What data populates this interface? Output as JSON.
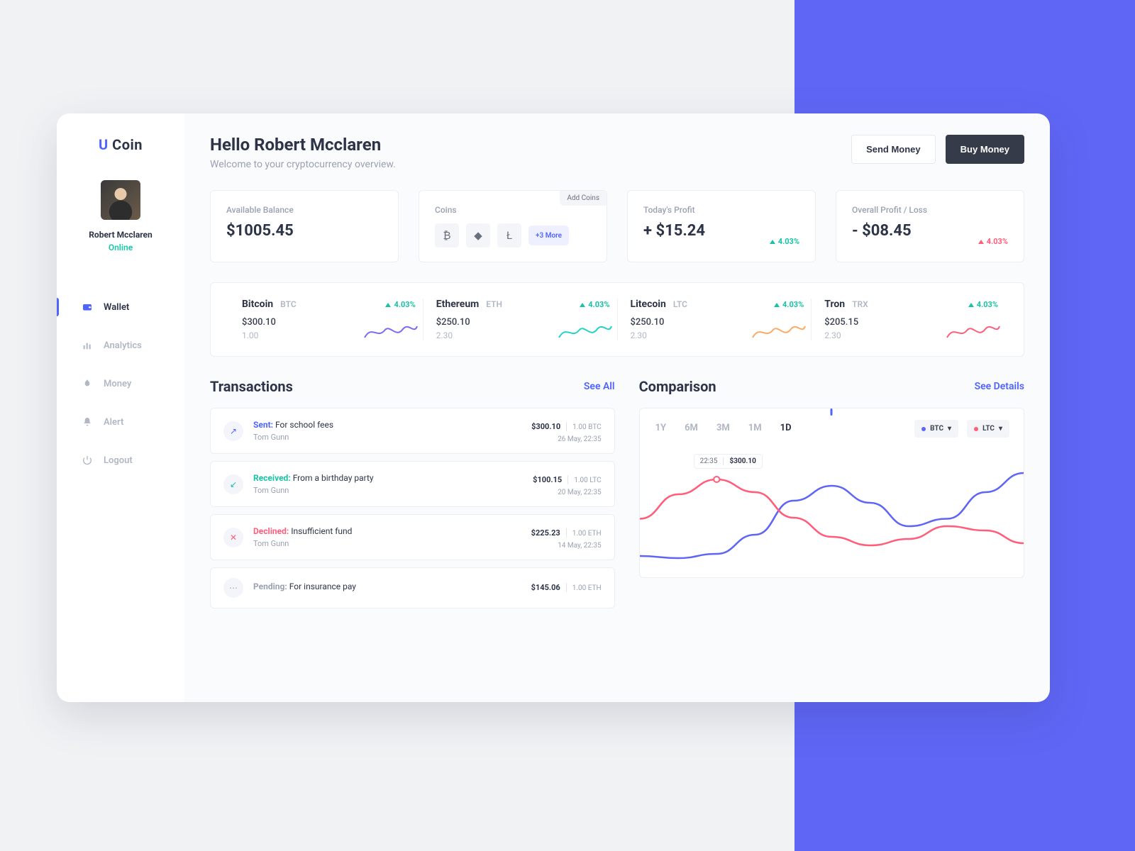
{
  "brand": {
    "u": "U",
    "coin": "Coin"
  },
  "user": {
    "name": "Robert Mcclaren",
    "status": "Online"
  },
  "nav": {
    "wallet": "Wallet",
    "analytics": "Analytics",
    "money": "Money",
    "alert": "Alert",
    "logout": "Logout"
  },
  "header": {
    "greeting": "Hello Robert Mcclaren",
    "subtitle": "Welcome to your cryptocurrency overview.",
    "send": "Send Money",
    "buy": "Buy Money"
  },
  "cards": {
    "balance": {
      "label": "Available Balance",
      "value": "$1005.45"
    },
    "coins": {
      "label": "Coins",
      "add": "Add Coins",
      "more": "+3 More",
      "sym1": "₿",
      "sym2": "◆",
      "sym3": "Ł"
    },
    "today": {
      "label": "Today's Profit",
      "value": "+ $15.24",
      "pct": "4.03%"
    },
    "overall": {
      "label": "Overall Profit / Loss",
      "value": "- $08.45",
      "pct": "4.03%"
    }
  },
  "coins": [
    {
      "name": "Bitcoin",
      "sym": "BTC",
      "price": "$300.10",
      "qty": "1.00",
      "pct": "4.03%",
      "spark_color": "#7a6bf4"
    },
    {
      "name": "Ethereum",
      "sym": "ETH",
      "price": "$250.10",
      "qty": "2.30",
      "pct": "4.03%",
      "spark_color": "#23d3c6"
    },
    {
      "name": "Litecoin",
      "sym": "LTC",
      "price": "$250.10",
      "qty": "2.30",
      "pct": "4.03%",
      "spark_color": "#ffa963"
    },
    {
      "name": "Tron",
      "sym": "TRX",
      "price": "$205.15",
      "qty": "2.30",
      "pct": "4.03%",
      "spark_color": "#ff5d7a"
    }
  ],
  "transactions": {
    "title": "Transactions",
    "link": "See All",
    "items": [
      {
        "status": "Sent:",
        "cls": "sent",
        "desc": "For school fees",
        "who": "Tom Gunn",
        "amt": "$300.10",
        "coin": "1.00 BTC",
        "date": "26 May, 22:35",
        "icon": "↗",
        "iconColor": "#4f63ff"
      },
      {
        "status": "Received:",
        "cls": "recv",
        "desc": "From a birthday party",
        "who": "Tom Gunn",
        "amt": "$100.15",
        "coin": "1.00 LTC",
        "date": "20 May, 22:35",
        "icon": "↙",
        "iconColor": "#17c3a4"
      },
      {
        "status": "Declined:",
        "cls": "decl",
        "desc": "Insufficient fund",
        "who": "Tom Gunn",
        "amt": "$225.23",
        "coin": "1.00 ETH",
        "date": "14 May, 22:35",
        "icon": "✕",
        "iconColor": "#ff5d7a"
      },
      {
        "status": "Pending:",
        "cls": "pend",
        "desc": "For insurance pay",
        "who": "",
        "amt": "$145.06",
        "coin": "1.00 ETH",
        "date": "",
        "icon": "⋯",
        "iconColor": "#9aa1b1"
      }
    ]
  },
  "comparison": {
    "title": "Comparison",
    "link": "See Details",
    "ranges": {
      "r1": "1Y",
      "r2": "6M",
      "r3": "3M",
      "r4": "1M",
      "r5": "1D"
    },
    "sel1": "BTC",
    "sel2": "LTC",
    "tooltip_time": "22:35",
    "tooltip_val": "$300.10"
  },
  "chart_data": {
    "type": "line",
    "x": [
      0,
      1,
      2,
      3,
      4,
      5,
      6,
      7,
      8,
      9,
      10
    ],
    "series": [
      {
        "name": "BTC",
        "color": "#5f66f5",
        "values": [
          20,
          18,
          22,
          40,
          72,
          86,
          70,
          48,
          55,
          80,
          98
        ]
      },
      {
        "name": "LTC",
        "color": "#ff5d7a",
        "values": [
          55,
          78,
          92,
          80,
          56,
          38,
          30,
          36,
          48,
          44,
          32
        ]
      }
    ],
    "ylim": [
      0,
      100
    ],
    "tooltip": {
      "x": 2,
      "series": "LTC",
      "time": "22:35",
      "value": "$300.10"
    }
  }
}
